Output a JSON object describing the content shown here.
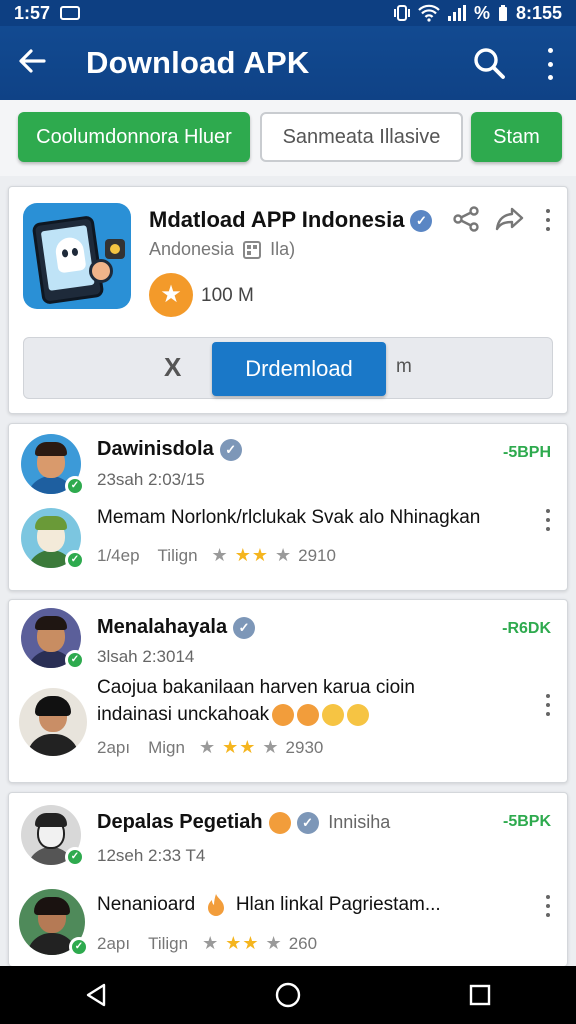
{
  "status_bar": {
    "time": "1:57",
    "battery_text": "%",
    "clock_right": "8:155"
  },
  "header": {
    "title": "Download APK"
  },
  "chips": [
    {
      "label": "Coolumdonnora Hluer"
    },
    {
      "label": "Sanmeata Illasive"
    },
    {
      "label": "Stam"
    }
  ],
  "app": {
    "title": "Mdatload APP Indonesia",
    "subtitle": "Andonesia",
    "subtitle_tail": "Ila)",
    "downloads": "100 M",
    "download_button": "Drdemload",
    "download_tail": "m",
    "download_left_icon": "X"
  },
  "reviews": [
    {
      "name": "Dawinisdola",
      "time": "23sah  2:03/15",
      "tag": "-5BPH",
      "text_lines": [
        "Memam Norlonk/rlclukak Svak alo Nhinagkan"
      ],
      "date": "1/4ep",
      "label": "Tilign",
      "rating": 3,
      "count": "2910"
    },
    {
      "name": "Menalahayala",
      "time": "3lsah  2:3014",
      "tag": "-R6DK",
      "text_lines": [
        "Caojua bakanilaan harven karua cioin",
        "indainasi unckahoak"
      ],
      "date": "2apı",
      "label": "Mign",
      "rating": 3,
      "count": "2930"
    },
    {
      "name": "Depalas Pegetiah",
      "name_suffix": "Innisiha",
      "time": "12seh  2:33 T4",
      "tag": "-5BPK",
      "text_lines": [
        "Nenanioard",
        "Hlan linkal Pagriestam..."
      ],
      "date": "2apı",
      "label": "Tilign",
      "rating": 3,
      "count": "260"
    }
  ],
  "icons": [
    "back-arrow-icon",
    "search-icon",
    "more-vert-icon",
    "verified-icon",
    "share-icon",
    "forward-icon",
    "star-icon",
    "nav-back-icon",
    "nav-home-icon",
    "nav-recents-icon"
  ],
  "colors": {
    "primary": "#0f4286",
    "accent_green": "#2eaa4e",
    "download_blue": "#1a78c8",
    "rating_orange": "#f39a2a",
    "star": "#f5b51e"
  }
}
